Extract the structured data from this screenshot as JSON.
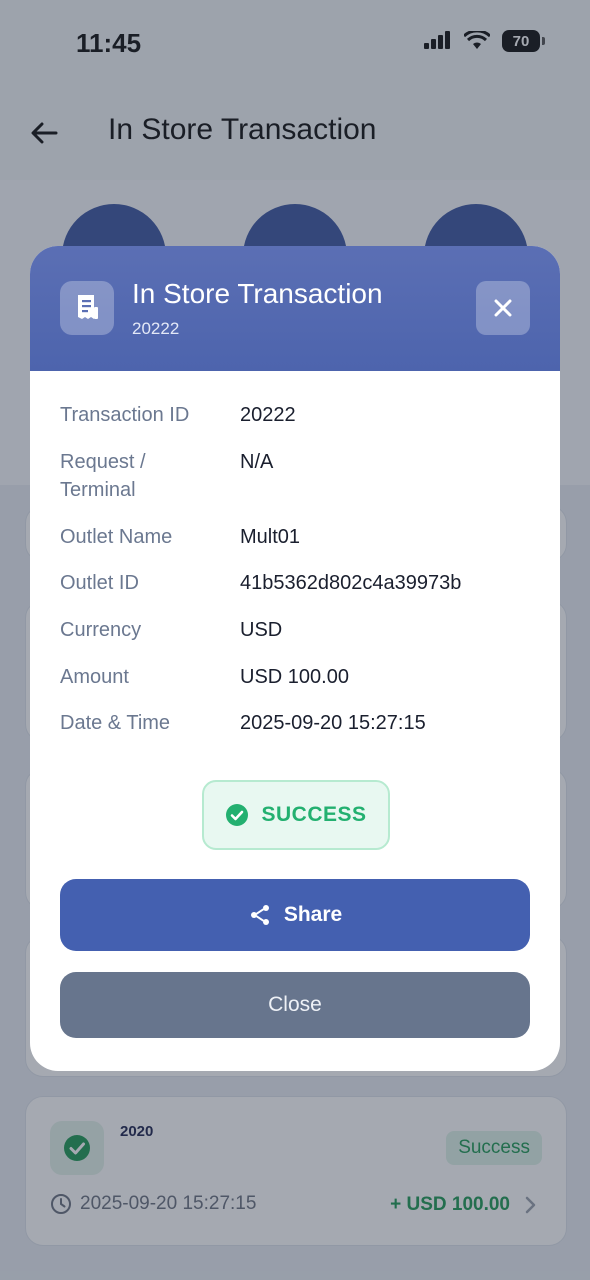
{
  "status_bar": {
    "time": "11:45",
    "battery": "70"
  },
  "header": {
    "title": "In Store Transaction"
  },
  "modal": {
    "title": "In Store Transaction",
    "subtitle": "20222",
    "details": [
      {
        "label": "Transaction ID",
        "value": "20222"
      },
      {
        "label": "Request / Terminal",
        "value": "N/A"
      },
      {
        "label": "Outlet Name",
        "value": "Mult01"
      },
      {
        "label": "Outlet ID",
        "value": "41b5362d802c4a39973b"
      },
      {
        "label": "Currency",
        "value": "USD"
      },
      {
        "label": "Amount",
        "value": "USD 100.00"
      },
      {
        "label": "Date & Time",
        "value": "2025-09-20 15:27:15"
      }
    ],
    "status": "SUCCESS",
    "share_label": "Share",
    "close_label": "Close"
  },
  "transaction_card": {
    "id": "2020",
    "badge": "Success",
    "date": "2025-09-20 15:27:15",
    "amount": "+ USD 100.00"
  },
  "colors": {
    "primary": "#4460b0",
    "success": "#23b070",
    "secondary_button": "#67758d"
  }
}
